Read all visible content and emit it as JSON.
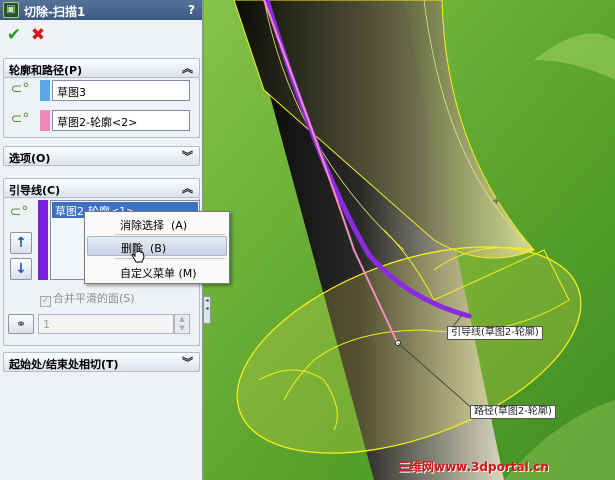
{
  "window": {
    "title": "切除-扫描1",
    "help": "?"
  },
  "actions": {
    "ok_icon": "check-icon",
    "cancel_icon": "close-icon"
  },
  "sections": {
    "profile_path": {
      "title": "轮廓和路径(P)",
      "profile_value": "草图3",
      "profile_color": "#5aa6e6",
      "path_value": "草图2-轮廓<2>",
      "path_color": "#f08ab8"
    },
    "options": {
      "title": "选项(O)"
    },
    "guide_curves": {
      "title": "引导线(C)",
      "items": [
        "草图2-轮廓<1>"
      ],
      "bar_color": "#7a1fe0",
      "merge_smooth_label": "合并平滑的面(S)",
      "merge_smooth_checked": true,
      "spin_value": "1"
    },
    "tangency": {
      "title": "起始处/结束处相切(T)"
    }
  },
  "context_menu": {
    "items": [
      {
        "label": "消除选择",
        "shortcut": "(A)"
      },
      {
        "label": "删除",
        "shortcut": "(B)"
      },
      {
        "label": "自定义菜单",
        "shortcut": "(M)"
      }
    ]
  },
  "viewport": {
    "callouts": {
      "guide": "引导线(草图2-轮廓)",
      "path": "路径(草图2-轮廓)"
    },
    "watermark": "三维网www.3dportal.cn",
    "background_color": "#6fb13a",
    "guide_color": "#8a2be2",
    "path_color": "#f090c0",
    "edge_color": "#f5ef1a"
  }
}
